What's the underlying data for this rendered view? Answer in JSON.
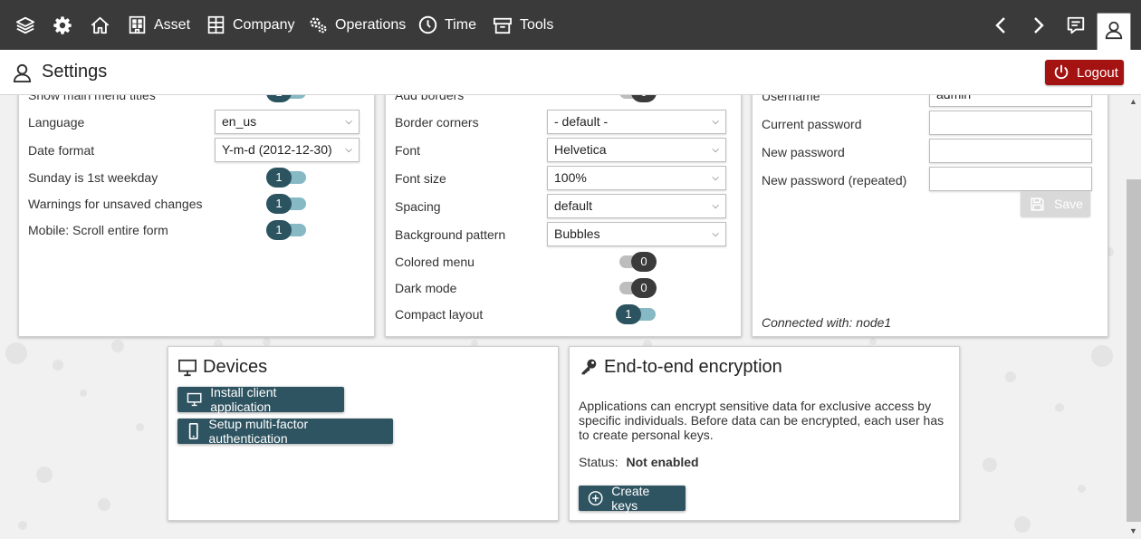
{
  "nav": {
    "asset": "Asset",
    "company": "Company",
    "operations": "Operations",
    "time": "Time",
    "tools": "Tools"
  },
  "page": {
    "title": "Settings",
    "logout": "Logout"
  },
  "general": {
    "cut_label": "Show main menu titles",
    "cut_value": "1",
    "language_label": "Language",
    "language_value": "en_us",
    "date_format_label": "Date format",
    "date_format_value": "Y-m-d (2012-12-30)",
    "sunday_label": "Sunday is 1st weekday",
    "sunday_value": "1",
    "warnings_label": "Warnings for unsaved changes",
    "warnings_value": "1",
    "mobile_label": "Mobile: Scroll entire form",
    "mobile_value": "1"
  },
  "appearance": {
    "cut_label": "Add borders",
    "cut_value": "0",
    "border_corners_label": "Border corners",
    "border_corners_value": "- default -",
    "font_label": "Font",
    "font_value": "Helvetica",
    "font_size_label": "Font size",
    "font_size_value": "100%",
    "spacing_label": "Spacing",
    "spacing_value": "default",
    "background_label": "Background pattern",
    "background_value": "Bubbles",
    "colored_menu_label": "Colored menu",
    "colored_menu_value": "0",
    "dark_mode_label": "Dark mode",
    "dark_mode_value": "0",
    "compact_label": "Compact layout",
    "compact_value": "1"
  },
  "account": {
    "username_label": "Username",
    "username_value": "admin",
    "current_password_label": "Current password",
    "new_password_label": "New password",
    "new_password_repeat_label": "New password (repeated)",
    "save": "Save",
    "connected": "Connected with: node1"
  },
  "devices": {
    "title": "Devices",
    "install": "Install client application",
    "mfa": "Setup multi-factor authentication"
  },
  "encryption": {
    "title": "End-to-end encryption",
    "description": "Applications can encrypt sensitive data for exclusive access by specific individuals. Before data can be encrypted, each user has to create personal keys.",
    "status_label": "Status:",
    "status_value": "Not enabled",
    "create_keys": "Create keys"
  }
}
